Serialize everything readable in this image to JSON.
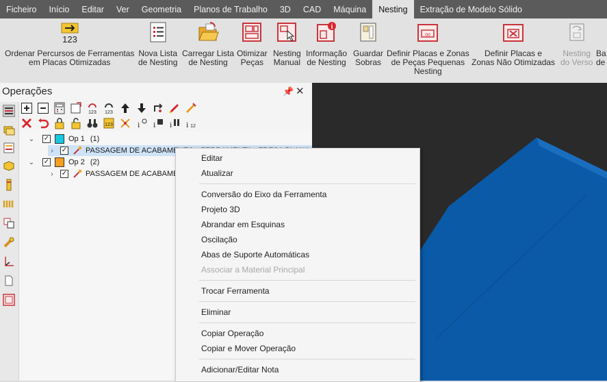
{
  "menubar": {
    "tabs": [
      "Ficheiro",
      "Início",
      "Editar",
      "Ver",
      "Geometria",
      "Planos de Trabalho",
      "3D",
      "CAD",
      "Máquina",
      "Nesting",
      "Extração de Modelo Sólido"
    ],
    "active_tab": "Nesting"
  },
  "ribbon": {
    "buttons": [
      {
        "line1": "Ordenar Percursos de Ferramentas",
        "line2": "em Placas Otimizadas",
        "line3": "",
        "icon": "sort-123-icon",
        "disabled": false
      },
      {
        "line1": "Nova Lista",
        "line2": "de Nesting",
        "line3": "",
        "icon": "list-icon",
        "disabled": false
      },
      {
        "line1": "Carregar Lista",
        "line2": "de Nesting",
        "line3": "",
        "icon": "folder-open-icon",
        "disabled": false
      },
      {
        "line1": "Otimizar",
        "line2": "Peças",
        "line3": "",
        "icon": "optimize-parts-icon",
        "disabled": false
      },
      {
        "line1": "Nesting",
        "line2": "Manual",
        "line3": "",
        "icon": "manual-nesting-icon",
        "disabled": false
      },
      {
        "line1": "Informação",
        "line2": "de Nesting",
        "line3": "",
        "icon": "nesting-info-icon",
        "disabled": false
      },
      {
        "line1": "Guardar",
        "line2": "Sobras",
        "line3": "",
        "icon": "save-remnants-icon",
        "disabled": false
      },
      {
        "line1": "Definir Placas e Zonas",
        "line2": "de Peças Pequenas",
        "line3": "Nesting",
        "icon": "small-parts-zone-icon",
        "disabled": false
      },
      {
        "line1": "Definir Placas e",
        "line2": "Zonas Não Otimizadas",
        "line3": "",
        "icon": "non-optimized-zone-icon",
        "disabled": false
      },
      {
        "line1": "Nesting",
        "line2": "do Verso",
        "line3": "",
        "icon": "reverse-nesting-icon",
        "disabled": true
      },
      {
        "line1": "Ba",
        "line2": "de",
        "line3": "",
        "icon": "partial-button-icon",
        "disabled": false
      }
    ]
  },
  "panel": {
    "title": "Operações",
    "pin_glyph": "📌",
    "close_glyph": "✕"
  },
  "tree": {
    "op1": {
      "label": "Op 1",
      "count": "(1)",
      "color": "#16c8e0",
      "child": "PASSAGEM DE ACABAMENTO - FERRAMENTA - FRESA PLANA"
    },
    "op2": {
      "label": "Op 2",
      "count": "(2)",
      "color": "#f5a020",
      "child": "PASSAGEM DE ACABAMENTO"
    }
  },
  "context_menu": {
    "items": [
      {
        "label": "Editar",
        "disabled": false
      },
      {
        "label": "Atualizar",
        "disabled": false
      },
      {
        "label": "Conversão do Eixo da Ferramenta",
        "disabled": false
      },
      {
        "label": "Projeto 3D",
        "disabled": false
      },
      {
        "label": "Abrandar em Esquinas",
        "disabled": false
      },
      {
        "label": "Oscilação",
        "disabled": false
      },
      {
        "label": "Abas de Suporte Automáticas",
        "disabled": false
      },
      {
        "label": "Associar a Material Principal",
        "disabled": true
      },
      {
        "label": "Trocar Ferramenta",
        "disabled": false
      },
      {
        "label": "Eliminar",
        "disabled": false
      },
      {
        "label": "Copiar Operação",
        "disabled": false
      },
      {
        "label": "Copiar e Mover Operação",
        "disabled": false
      },
      {
        "label": "Adicionar/Editar Nota",
        "disabled": false
      }
    ]
  },
  "colors": {
    "menubar_bg": "#5b5b5b",
    "ribbon_bg": "#e2e2e2",
    "viewport_bg": "#2a2a2a",
    "part_blue": "#0a5aa8",
    "accent_red": "#c8343c"
  }
}
